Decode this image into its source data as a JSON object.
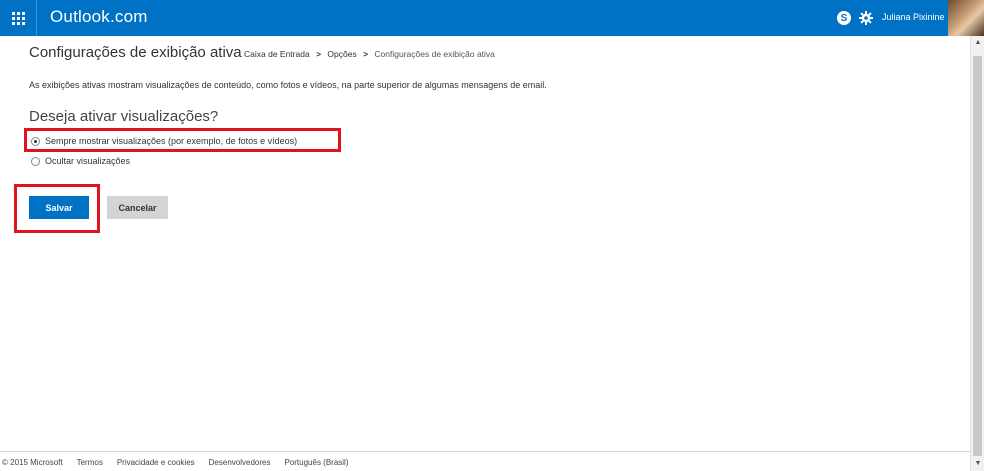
{
  "app": {
    "brand": "Outlook.com",
    "user_name": "Juliana Pixinine"
  },
  "header": {
    "title": "Configurações de exibição ativa",
    "breadcrumb": {
      "item1": "Caixa de Entrada",
      "item2": "Opções",
      "current": "Configurações de exibição ativa",
      "separator": ">"
    }
  },
  "main": {
    "description": "As exibições ativas mostram visualizações de conteúdo, como fotos e vídeos, na parte superior de algumas mensagens de email.",
    "question": "Deseja ativar visualizações?",
    "options": [
      {
        "label": "Sempre mostrar visualizações (por exemplo, de fotos e vídeos)",
        "selected": true
      },
      {
        "label": "Ocultar visualizações",
        "selected": false
      }
    ],
    "save_label": "Salvar",
    "cancel_label": "Cancelar"
  },
  "footer": {
    "copyright": "© 2015 Microsoft",
    "terms": "Termos",
    "privacy": "Privacidade e cookies",
    "developers": "Desenvolvedores",
    "language": "Português (Brasil)"
  },
  "colors": {
    "accent": "#0072c6",
    "highlight": "#e0141e"
  },
  "icons": [
    "app-launcher-icon",
    "skype-icon",
    "gear-icon"
  ]
}
